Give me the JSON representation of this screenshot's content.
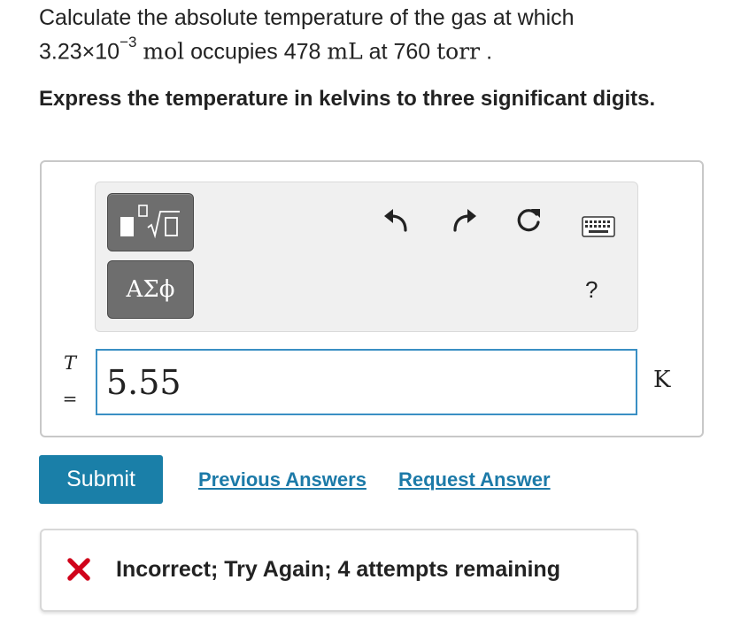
{
  "question": {
    "line1": "Calculate the absolute temperature of the gas at which",
    "amount": "3.23×10",
    "amount_exp": "−3",
    "mol_unit": "mol",
    "occupies": " occupies 478 ",
    "ml_unit": "mL",
    "at": " at 760 ",
    "torr_unit": "torr",
    "period": " .",
    "instruction": "Express the temperature in kelvins to three significant digits."
  },
  "toolbar": {
    "greek_label": "ΑΣϕ",
    "help_label": "?",
    "icons": [
      "templates-icon",
      "undo-icon",
      "redo-icon",
      "reset-icon",
      "keyboard-icon"
    ]
  },
  "answer": {
    "variable": "T",
    "equals": "=",
    "value": "5.55",
    "unit": "K"
  },
  "actions": {
    "submit_label": "Submit",
    "previous_answers": "Previous Answers",
    "request_answer": "Request Answer"
  },
  "feedback": {
    "message": "Incorrect; Try Again; 4 attempts remaining",
    "status_color": "#d0021b"
  },
  "colors": {
    "accent": "#1a7fa8",
    "link": "#1c7aa8",
    "input_border": "#3a8fc4",
    "toolbar_button": "#6e6e6e"
  }
}
